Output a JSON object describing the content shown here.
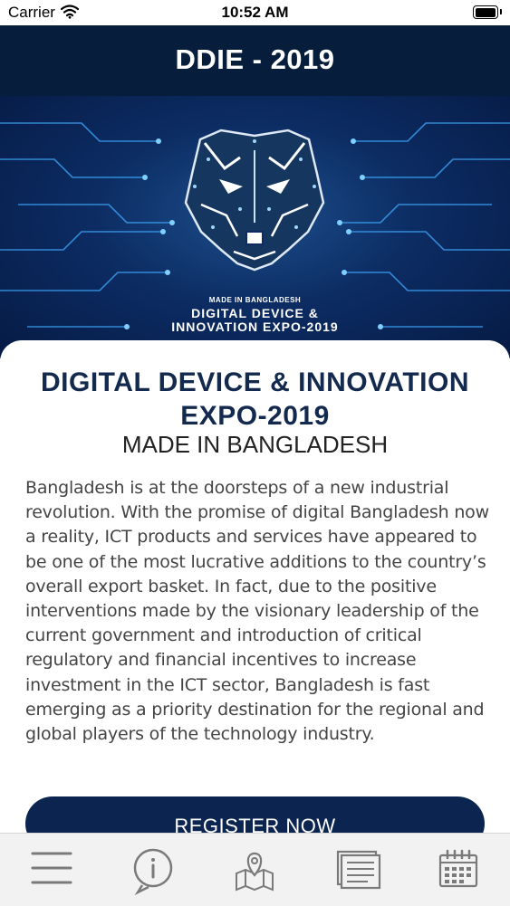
{
  "status_bar": {
    "carrier": "Carrier",
    "time": "10:52 AM"
  },
  "nav": {
    "title": "DDIE - 2019"
  },
  "hero": {
    "small_text": "MADE IN BANGLADESH",
    "line1": "DIGITAL DEVICE &",
    "line2": "INNOVATION EXPO-2019",
    "icon": "tiger-logo"
  },
  "card": {
    "title": "DIGITAL DEVICE & INNOVATION EXPO-2019",
    "subtitle": "MADE IN BANGLADESH",
    "body": "Bangladesh is at the doorsteps of a new industrial revolution. With the promise of digital Bangladesh now a reality, ICT products and services have appeared to be one of the most lucrative additions to the country’s overall export basket. In fact, due to the positive interventions made by the visionary leadership of the current government and introduction of critical regulatory and financial incentives to increase investment in the ICT sector, Bangladesh is fast emerging as a priority destination for the regional and global players of the technology industry."
  },
  "register_button": {
    "label": "REGISTER NOW"
  },
  "tab_bar": {
    "items": [
      {
        "icon": "menu-icon"
      },
      {
        "icon": "info-icon"
      },
      {
        "icon": "map-pin-icon"
      },
      {
        "icon": "news-icon"
      },
      {
        "icon": "calendar-icon"
      }
    ]
  },
  "colors": {
    "nav_background": "#061e3b",
    "hero_background": "#0c2c63",
    "title_color": "#13294d",
    "button_background": "#0b2550",
    "tab_bar_background": "#f2f2f2",
    "icon_color": "#7a7a7a"
  }
}
